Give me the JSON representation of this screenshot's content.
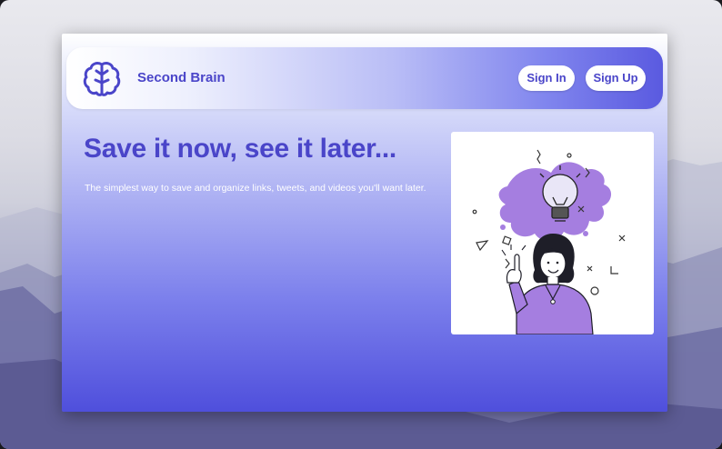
{
  "brand": {
    "name": "Second Brain",
    "logo_icon": "brain-icon"
  },
  "nav": {
    "sign_in_label": "Sign In",
    "sign_up_label": "Sign Up"
  },
  "hero": {
    "title": "Save it now, see it later...",
    "subtitle": "The simplest way to save and organize links, tweets, and videos you'll want later.",
    "illustration_icon": "woman-lightbulb-idea-illustration"
  },
  "colors": {
    "brand_purple": "#4a45c9",
    "accent_lilac": "#a57ee0"
  }
}
